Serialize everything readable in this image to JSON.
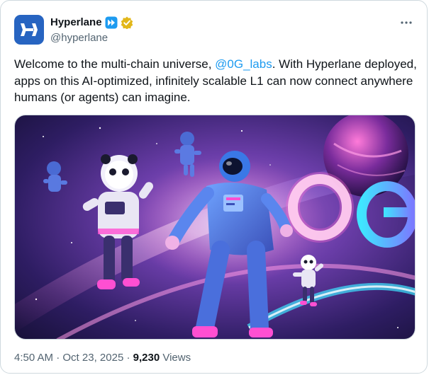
{
  "author": {
    "display_name": "Hyperlane",
    "handle": "@hyperlane",
    "avatar_icon": "hyperlane-logo-icon",
    "badges": [
      "automated-account-icon",
      "gold-verified-badge-icon"
    ],
    "avatar_color": "#2764c1",
    "verified_color": "#e2b719"
  },
  "tweet": {
    "text_before": "Welcome to the multi-chain universe, ",
    "mention": "@0G_labs",
    "text_after": ". With Hyperlane deployed, apps on this AI-optimized, infinitely scalable L1 can now connect anywhere humans (or agents) can imagine.",
    "image_alt": "Illustration of astronauts and panda astronauts floating in a purple galaxy beside a glowing 0G logo"
  },
  "meta": {
    "time": "4:50 AM",
    "separator": " · ",
    "date": "Oct 23, 2025",
    "views_count": "9,230",
    "views_label": " Views"
  },
  "menu": {
    "more_icon": "more-options-icon"
  },
  "colors": {
    "text": "#0f1419",
    "secondary": "#536471",
    "link": "#1d9bf0",
    "border": "#cfd9de"
  }
}
